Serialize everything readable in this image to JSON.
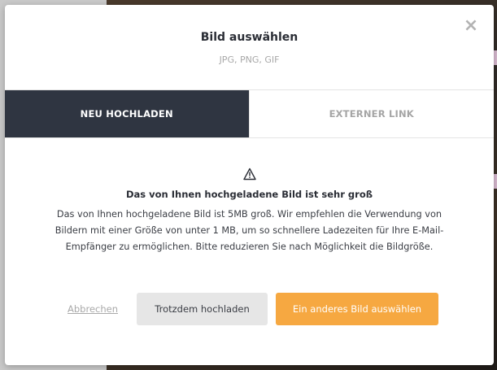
{
  "modal": {
    "close_label": "×",
    "title": "Bild auswählen",
    "subtitle": "JPG, PNG, GIF"
  },
  "tabs": [
    {
      "label": "NEU HOCHLADEN",
      "active": true
    },
    {
      "label": "EXTERNER LINK",
      "active": false
    }
  ],
  "warning": {
    "icon": "warning-triangle-icon",
    "title": "Das von Ihnen hochgeladene Bild ist sehr groß",
    "text": "Das von Ihnen hochgeladene Bild ist 5MB groß. Wir empfehlen die Verwendung von Bildern mit einer Größe von unter 1 MB, um so schnellere Ladezeiten für Ihre E-Mail-Empfänger zu ermöglichen. Bitte reduzieren Sie nach Möglichkeit die Bildgröße."
  },
  "actions": {
    "cancel_label": "Abbrechen",
    "upload_anyway_label": "Trotzdem hochladen",
    "choose_other_label": "Ein anderes Bild auswählen"
  },
  "colors": {
    "active_tab_bg": "#2f3541",
    "primary_button": "#f6a841",
    "secondary_button": "#e6e6e6"
  }
}
